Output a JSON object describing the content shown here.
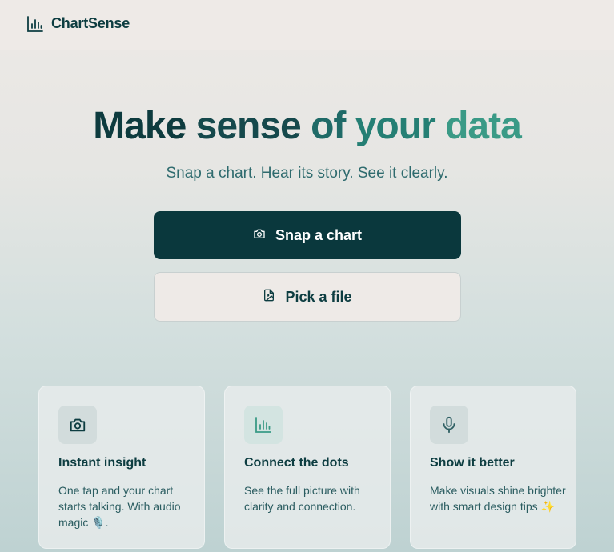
{
  "header": {
    "brand": "ChartSense",
    "logo_icon": "bar-chart-icon"
  },
  "hero": {
    "headline_parts": [
      "Make",
      "sense",
      "of",
      "your",
      "data"
    ],
    "headline_colors": [
      "#0d3b3e",
      "#15494c",
      "#1f6a67",
      "#257f74",
      "#3a9a86"
    ],
    "subtitle": "Snap a chart. Hear its story. See it clearly."
  },
  "actions": {
    "snap_label": "Snap a chart",
    "snap_icon": "camera-icon",
    "pick_label": "Pick a file",
    "pick_icon": "file-image-icon"
  },
  "features": [
    {
      "title": "Instant insight",
      "text": "One tap and your chart starts talking. With audio magic 🎙️.",
      "icon": "camera-icon",
      "icon_bg": "#d2dcdc"
    },
    {
      "title": "Connect the dots",
      "text": "See the full picture with clarity and connection.",
      "icon": "bar-chart-icon",
      "icon_bg": "#d3e4e1"
    },
    {
      "title": "Show it better",
      "text": "Make visuals shine brighter with smart design tips ✨",
      "icon": "microphone-icon",
      "icon_bg": "#d2dcdc"
    }
  ]
}
